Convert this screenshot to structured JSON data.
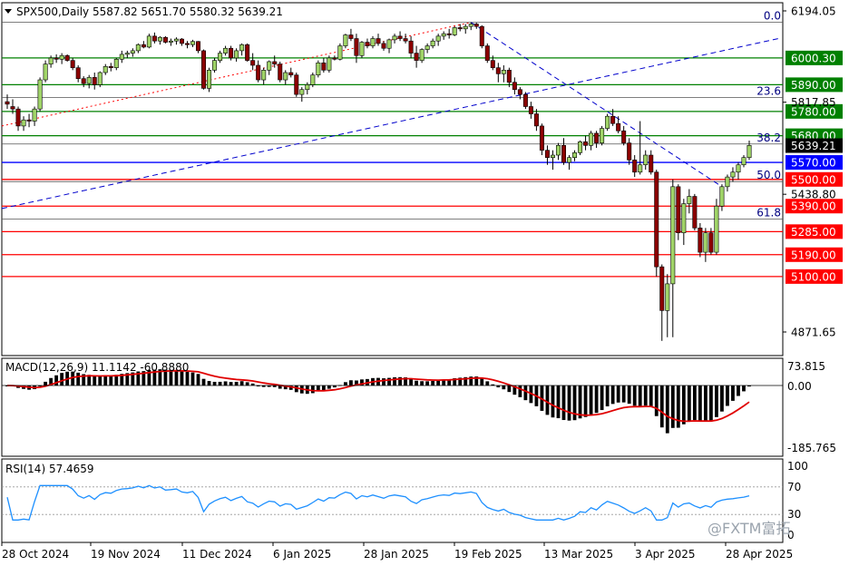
{
  "chart_data": {
    "type": "candlestick",
    "header": {
      "symbol": "SPX500,Daily",
      "open": "5587.82",
      "high": "5651.70",
      "low": "5580.32",
      "close": "5639.21"
    },
    "price_axis": {
      "range": [
        4800,
        6200
      ],
      "labels": [
        "6194.05",
        "6000.30",
        "5890.00",
        "5817.85",
        "5780.00",
        "5680.00",
        "5570.00",
        "5500.00",
        "5438.80",
        "5390.00",
        "5285.00",
        "5190.00",
        "5100.00",
        "4871.65"
      ]
    },
    "x_labels": [
      "28 Oct 2024",
      "19 Nov 2024",
      "11 Dec 2024",
      "6 Jan 2025",
      "28 Jan 2025",
      "19 Feb 2025",
      "13 Mar 2025",
      "3 Apr 2025",
      "28 Apr 2025"
    ],
    "horizontal_levels": [
      {
        "value": 6000.3,
        "label": "6000.30",
        "color": "#008000"
      },
      {
        "value": 5890.0,
        "label": "5890.00",
        "color": "#008000"
      },
      {
        "value": 5780.0,
        "label": "5780.00",
        "color": "#008000"
      },
      {
        "value": 5680.0,
        "label": "5680.00",
        "color": "#008000"
      },
      {
        "value": 5570.0,
        "label": "5570.00",
        "color": "#0000ff"
      },
      {
        "value": 5500.0,
        "label": "5500.00",
        "color": "#ff0000"
      },
      {
        "value": 5390.0,
        "label": "5390.00",
        "color": "#ff0000"
      },
      {
        "value": 5285.0,
        "label": "5285.00",
        "color": "#ff0000"
      },
      {
        "value": 5190.0,
        "label": "5190.00",
        "color": "#ff0000"
      },
      {
        "value": 5100.0,
        "label": "5100.00",
        "color": "#ff0000"
      }
    ],
    "fibonacci": {
      "high": 6147,
      "low": 4835,
      "levels": [
        {
          "label": "0.0",
          "ratio": 0.0
        },
        {
          "label": "23.6",
          "ratio": 0.236
        },
        {
          "label": "38.2",
          "ratio": 0.382
        },
        {
          "label": "50.0",
          "ratio": 0.5
        },
        {
          "label": "61.8",
          "ratio": 0.618
        }
      ]
    },
    "candles": [
      [
        5820,
        5850,
        5790,
        5810
      ],
      [
        5800,
        5830,
        5770,
        5790
      ],
      [
        5790,
        5800,
        5700,
        5720
      ],
      [
        5720,
        5760,
        5700,
        5745
      ],
      [
        5745,
        5770,
        5715,
        5740
      ],
      [
        5740,
        5800,
        5720,
        5790
      ],
      [
        5790,
        5920,
        5780,
        5910
      ],
      [
        5910,
        5990,
        5900,
        5975
      ],
      [
        5975,
        6010,
        5960,
        6000
      ],
      [
        6000,
        6015,
        5980,
        5995
      ],
      [
        5995,
        6020,
        5975,
        6010
      ],
      [
        6010,
        6015,
        5985,
        5990
      ],
      [
        5990,
        6000,
        5950,
        5960
      ],
      [
        5960,
        5970,
        5900,
        5915
      ],
      [
        5915,
        5925,
        5880,
        5895
      ],
      [
        5895,
        5930,
        5875,
        5920
      ],
      [
        5920,
        5940,
        5870,
        5890
      ],
      [
        5890,
        5945,
        5880,
        5940
      ],
      [
        5940,
        5975,
        5930,
        5965
      ],
      [
        5965,
        5980,
        5945,
        5960
      ],
      [
        5960,
        6000,
        5950,
        5995
      ],
      [
        5995,
        6030,
        5980,
        6015
      ],
      [
        6015,
        6030,
        6000,
        6020
      ],
      [
        6020,
        6040,
        6005,
        6030
      ],
      [
        6030,
        6060,
        6020,
        6055
      ],
      [
        6055,
        6070,
        6040,
        6045
      ],
      [
        6045,
        6100,
        6040,
        6090
      ],
      [
        6090,
        6105,
        6060,
        6070
      ],
      [
        6070,
        6090,
        6055,
        6085
      ],
      [
        6085,
        6090,
        6060,
        6065
      ],
      [
        6065,
        6080,
        6050,
        6070
      ],
      [
        6070,
        6085,
        6055,
        6078
      ],
      [
        6078,
        6082,
        6050,
        6060
      ],
      [
        6060,
        6070,
        6040,
        6055
      ],
      [
        6055,
        6075,
        6045,
        6068
      ],
      [
        6068,
        6070,
        6020,
        6030
      ],
      [
        6030,
        6035,
        5870,
        5875
      ],
      [
        5875,
        5960,
        5860,
        5950
      ],
      [
        5950,
        6000,
        5940,
        5990
      ],
      [
        5990,
        6030,
        5980,
        6020
      ],
      [
        6020,
        6050,
        6010,
        6040
      ],
      [
        6040,
        6050,
        5990,
        6000
      ],
      [
        6000,
        6040,
        5985,
        6030
      ],
      [
        6030,
        6060,
        6010,
        6055
      ],
      [
        6055,
        6060,
        5985,
        5990
      ],
      [
        5990,
        6020,
        5950,
        5970
      ],
      [
        5970,
        5990,
        5900,
        5910
      ],
      [
        5910,
        5960,
        5890,
        5950
      ],
      [
        5950,
        5990,
        5930,
        5985
      ],
      [
        5985,
        6010,
        5960,
        5975
      ],
      [
        5975,
        5985,
        5900,
        5910
      ],
      [
        5910,
        5950,
        5890,
        5940
      ],
      [
        5940,
        5960,
        5920,
        5930
      ],
      [
        5930,
        5940,
        5840,
        5850
      ],
      [
        5850,
        5880,
        5820,
        5870
      ],
      [
        5870,
        5900,
        5850,
        5890
      ],
      [
        5890,
        5940,
        5880,
        5930
      ],
      [
        5930,
        5990,
        5920,
        5980
      ],
      [
        5980,
        6000,
        5940,
        5950
      ],
      [
        5950,
        6010,
        5940,
        6000
      ],
      [
        6000,
        6010,
        5990,
        5995
      ],
      [
        5995,
        6060,
        5990,
        6050
      ],
      [
        6050,
        6100,
        6040,
        6095
      ],
      [
        6095,
        6120,
        6070,
        6080
      ],
      [
        6080,
        6100,
        5980,
        6010
      ],
      [
        6010,
        6070,
        6000,
        6065
      ],
      [
        6065,
        6080,
        6040,
        6050
      ],
      [
        6050,
        6090,
        6040,
        6080
      ],
      [
        6080,
        6100,
        6050,
        6060
      ],
      [
        6060,
        6070,
        6030,
        6040
      ],
      [
        6040,
        6080,
        6020,
        6075
      ],
      [
        6075,
        6100,
        6060,
        6090
      ],
      [
        6090,
        6110,
        6070,
        6080
      ],
      [
        6080,
        6100,
        6060,
        6070
      ],
      [
        6070,
        6090,
        6000,
        6020
      ],
      [
        6020,
        6050,
        5960,
        5990
      ],
      [
        5990,
        6040,
        5980,
        6035
      ],
      [
        6035,
        6060,
        6020,
        6050
      ],
      [
        6050,
        6080,
        6040,
        6070
      ],
      [
        6070,
        6100,
        6050,
        6090
      ],
      [
        6090,
        6110,
        6075,
        6100
      ],
      [
        6100,
        6120,
        6080,
        6095
      ],
      [
        6095,
        6130,
        6090,
        6125
      ],
      [
        6125,
        6140,
        6110,
        6120
      ],
      [
        6120,
        6140,
        6100,
        6130
      ],
      [
        6130,
        6147,
        6115,
        6140
      ],
      [
        6140,
        6145,
        6120,
        6130
      ],
      [
        6130,
        6135,
        6040,
        6050
      ],
      [
        6050,
        6060,
        5980,
        5990
      ],
      [
        5990,
        6010,
        5950,
        5960
      ],
      [
        5960,
        5980,
        5900,
        5935
      ],
      [
        5935,
        5970,
        5900,
        5950
      ],
      [
        5950,
        5960,
        5880,
        5900
      ],
      [
        5900,
        5920,
        5850,
        5870
      ],
      [
        5870,
        5880,
        5830,
        5850
      ],
      [
        5850,
        5860,
        5790,
        5800
      ],
      [
        5800,
        5820,
        5750,
        5770
      ],
      [
        5770,
        5790,
        5700,
        5720
      ],
      [
        5720,
        5730,
        5600,
        5620
      ],
      [
        5620,
        5640,
        5560,
        5590
      ],
      [
        5590,
        5620,
        5540,
        5600
      ],
      [
        5600,
        5650,
        5580,
        5640
      ],
      [
        5640,
        5670,
        5560,
        5570
      ],
      [
        5570,
        5600,
        5540,
        5590
      ],
      [
        5590,
        5620,
        5575,
        5610
      ],
      [
        5610,
        5660,
        5600,
        5655
      ],
      [
        5655,
        5680,
        5620,
        5640
      ],
      [
        5640,
        5700,
        5620,
        5690
      ],
      [
        5690,
        5700,
        5630,
        5650
      ],
      [
        5650,
        5720,
        5640,
        5710
      ],
      [
        5710,
        5770,
        5700,
        5760
      ],
      [
        5760,
        5790,
        5720,
        5730
      ],
      [
        5730,
        5760,
        5690,
        5700
      ],
      [
        5700,
        5720,
        5640,
        5650
      ],
      [
        5650,
        5670,
        5560,
        5580
      ],
      [
        5580,
        5600,
        5510,
        5530
      ],
      [
        5530,
        5740,
        5520,
        5560
      ],
      [
        5560,
        5620,
        5540,
        5600
      ],
      [
        5600,
        5620,
        5520,
        5530
      ],
      [
        5530,
        5540,
        5100,
        5140
      ],
      [
        5140,
        5150,
        4835,
        4960
      ],
      [
        4960,
        5110,
        4850,
        5070
      ],
      [
        5070,
        5500,
        4850,
        5470
      ],
      [
        5470,
        5480,
        5250,
        5280
      ],
      [
        5280,
        5420,
        5230,
        5400
      ],
      [
        5400,
        5460,
        5360,
        5430
      ],
      [
        5430,
        5440,
        5290,
        5300
      ],
      [
        5300,
        5320,
        5180,
        5200
      ],
      [
        5200,
        5300,
        5160,
        5280
      ],
      [
        5280,
        5300,
        5190,
        5200
      ],
      [
        5200,
        5420,
        5190,
        5390
      ],
      [
        5390,
        5480,
        5370,
        5470
      ],
      [
        5470,
        5520,
        5450,
        5510
      ],
      [
        5510,
        5550,
        5490,
        5530
      ],
      [
        5530,
        5570,
        5500,
        5560
      ],
      [
        5560,
        5600,
        5550,
        5590
      ],
      [
        5590,
        5660,
        5580,
        5640
      ]
    ],
    "trendlines": [
      {
        "style": "dotted",
        "color": "#ff0000"
      },
      {
        "style": "dashed",
        "color": "#0000cc"
      },
      {
        "style": "dashed",
        "color": "#0000cc"
      }
    ],
    "macd": {
      "label": "MACD(12,26,9) 11.1142 -60.8880",
      "axis_labels": [
        "73.815",
        "0.00",
        "-185.765"
      ],
      "range": [
        -186,
        74
      ]
    },
    "rsi": {
      "label": "RSI(14) 57.4659",
      "axis_labels": [
        "100",
        "70",
        "30",
        "0"
      ],
      "levels": [
        70,
        30
      ],
      "color": "#1e90ff"
    },
    "current_price_label": "5639.21"
  },
  "watermark": "@FXTM富拓"
}
